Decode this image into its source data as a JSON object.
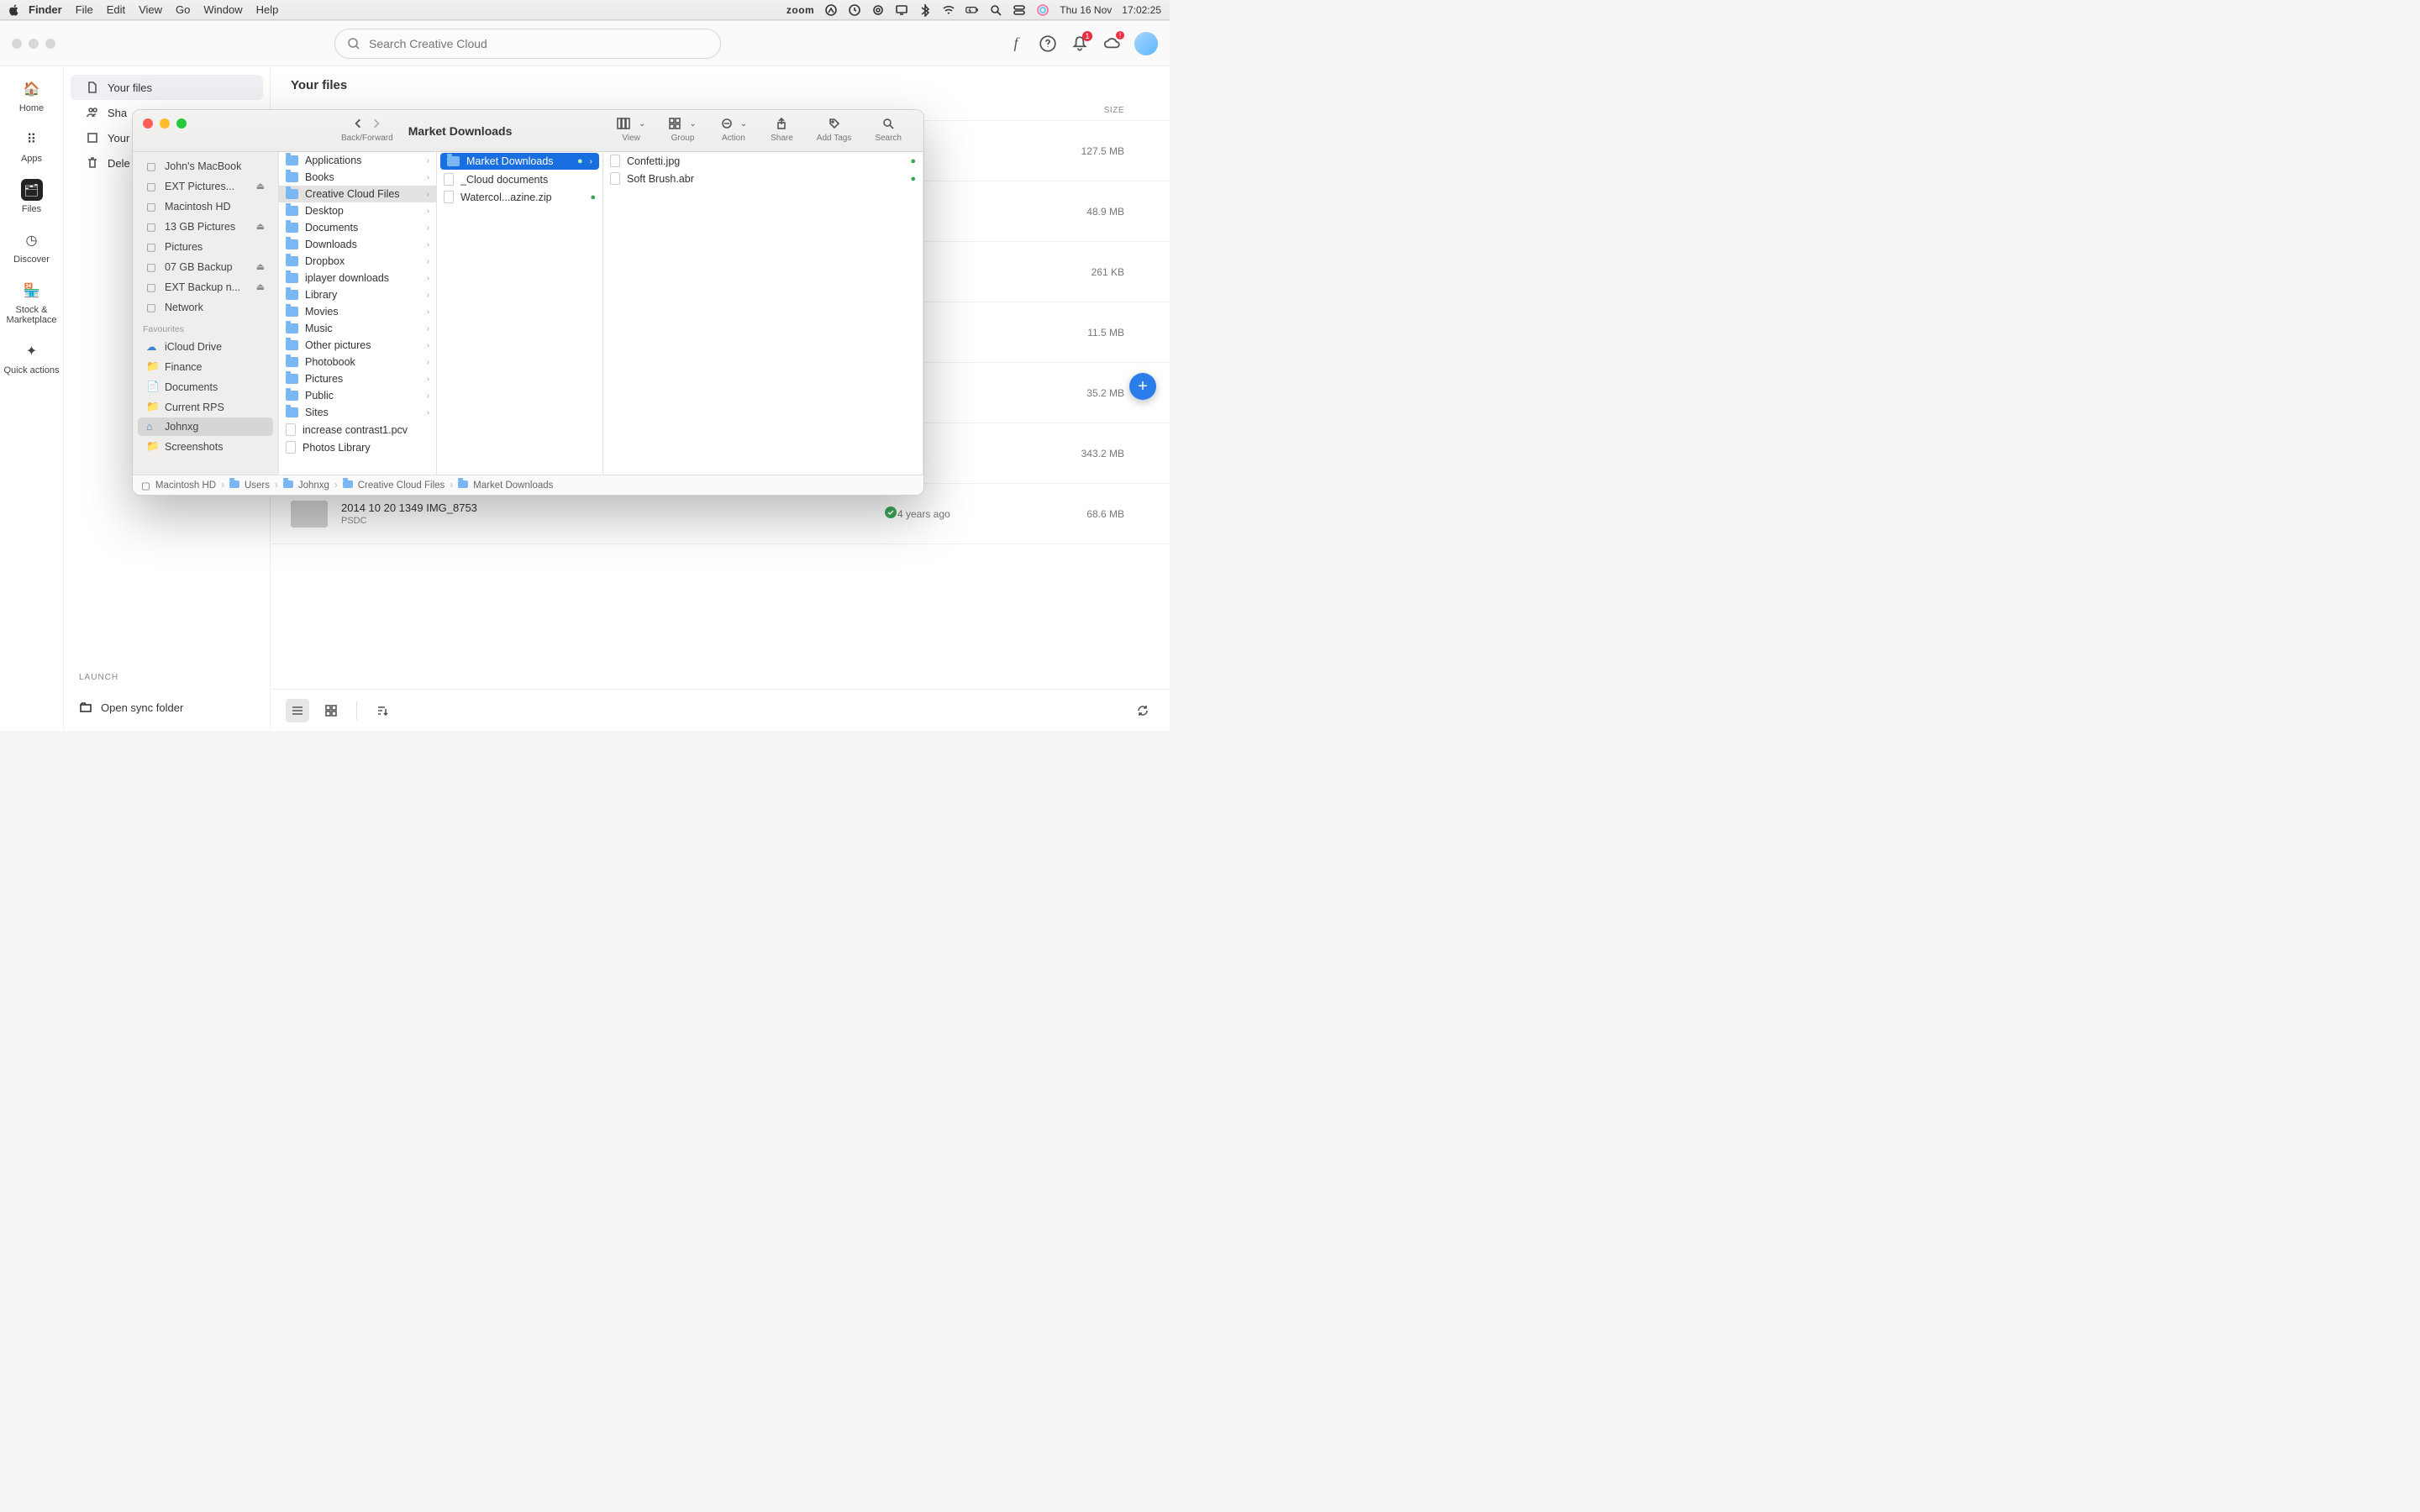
{
  "menubar": {
    "app": "Finder",
    "items": [
      "File",
      "Edit",
      "View",
      "Go",
      "Window",
      "Help"
    ],
    "zoom": "zoom",
    "date": "Thu 16 Nov",
    "time": "17:02:25"
  },
  "cc": {
    "search_placeholder": "Search Creative Cloud",
    "notif_badge": "1",
    "rail": [
      {
        "label": "Home",
        "icon": "home"
      },
      {
        "label": "Apps",
        "icon": "grid"
      },
      {
        "label": "Files",
        "icon": "folder",
        "active": true
      },
      {
        "label": "Discover",
        "icon": "compass"
      },
      {
        "label": "Stock & Marketplace",
        "icon": "store"
      },
      {
        "label": "Quick actions",
        "icon": "sparkle"
      }
    ],
    "side": {
      "items": [
        {
          "label": "Your files",
          "icon": "file",
          "selected": true
        },
        {
          "label": "Sha",
          "icon": "user"
        },
        {
          "label": "Your",
          "icon": "square"
        },
        {
          "label": "Dele",
          "icon": "trash"
        }
      ],
      "launch_label": "LAUNCH",
      "sync_label": "Open sync folder"
    },
    "main": {
      "title": "Your files",
      "col_size": "SIZE",
      "rows": [
        {
          "size": "127.5 MB"
        },
        {
          "size": "48.9 MB"
        },
        {
          "size": "261 KB"
        },
        {
          "size": "11.5 MB"
        },
        {
          "size": "35.2 MB"
        },
        {
          "size": "343.2 MB"
        },
        {
          "name": "2014 10 20 1349 IMG_8753",
          "type": "PSDC",
          "date": "4 years ago",
          "size": "68.6 MB",
          "status": true
        }
      ]
    }
  },
  "finder": {
    "title": "Market Downloads",
    "toolbar": {
      "back_forward": "Back/Forward",
      "view": "View",
      "group": "Group",
      "action": "Action",
      "share": "Share",
      "add_tags": "Add Tags",
      "search": "Search"
    },
    "sidebar": {
      "locations": [
        {
          "label": "John's MacBook",
          "icon": "laptop"
        },
        {
          "label": "EXT Pictures...",
          "icon": "drive",
          "eject": true
        },
        {
          "label": "Macintosh HD",
          "icon": "drive"
        },
        {
          "label": "13 GB Pictures",
          "icon": "drive",
          "eject": true
        },
        {
          "label": "Pictures",
          "icon": "drive"
        },
        {
          "label": "07 GB Backup",
          "icon": "drive",
          "eject": true
        },
        {
          "label": "EXT Backup n...",
          "icon": "drive",
          "eject": true
        },
        {
          "label": "Network",
          "icon": "globe"
        }
      ],
      "fav_header": "Favourites",
      "favourites": [
        {
          "label": "iCloud Drive",
          "icon": "cloud"
        },
        {
          "label": "Finance",
          "icon": "folder"
        },
        {
          "label": "Documents",
          "icon": "doc"
        },
        {
          "label": "Current RPS",
          "icon": "folder"
        },
        {
          "label": "Johnxg",
          "icon": "home",
          "selected": true
        },
        {
          "label": "Screenshots",
          "icon": "folder"
        }
      ]
    },
    "col1": [
      {
        "label": "Applications",
        "folder": true,
        "chev": true
      },
      {
        "label": "Books",
        "folder": true,
        "chev": true
      },
      {
        "label": "Creative Cloud Files",
        "folder": true,
        "chev": true,
        "selected": "light"
      },
      {
        "label": "Desktop",
        "folder": true,
        "chev": true
      },
      {
        "label": "Documents",
        "folder": true,
        "chev": true
      },
      {
        "label": "Downloads",
        "folder": true,
        "chev": true
      },
      {
        "label": "Dropbox",
        "folder": true,
        "chev": true
      },
      {
        "label": "iplayer downloads",
        "folder": true,
        "chev": true
      },
      {
        "label": "Library",
        "folder": true,
        "chev": true
      },
      {
        "label": "Movies",
        "folder": true,
        "chev": true
      },
      {
        "label": "Music",
        "folder": true,
        "chev": true
      },
      {
        "label": "Other pictures",
        "folder": true,
        "chev": true
      },
      {
        "label": "Photobook",
        "folder": true,
        "chev": true
      },
      {
        "label": "Pictures",
        "folder": true,
        "chev": true
      },
      {
        "label": "Public",
        "folder": true,
        "chev": true
      },
      {
        "label": "Sites",
        "folder": true,
        "chev": true
      },
      {
        "label": "increase contrast1.pcv",
        "folder": false
      },
      {
        "label": "Photos Library",
        "folder": false,
        "photos": true
      }
    ],
    "col2": [
      {
        "label": "Market Downloads",
        "folder": true,
        "chev": true,
        "selected": "blue",
        "check": true
      },
      {
        "label": "_Cloud documents",
        "folder": false,
        "cloud": true
      },
      {
        "label": "Watercol...azine.zip",
        "folder": false,
        "check": true
      }
    ],
    "col3": [
      {
        "label": "Confetti.jpg",
        "folder": false,
        "check": true
      },
      {
        "label": "Soft Brush.abr",
        "folder": false,
        "check": true
      }
    ],
    "path": [
      "Macintosh HD",
      "Users",
      "Johnxg",
      "Creative Cloud Files",
      "Market Downloads"
    ]
  }
}
